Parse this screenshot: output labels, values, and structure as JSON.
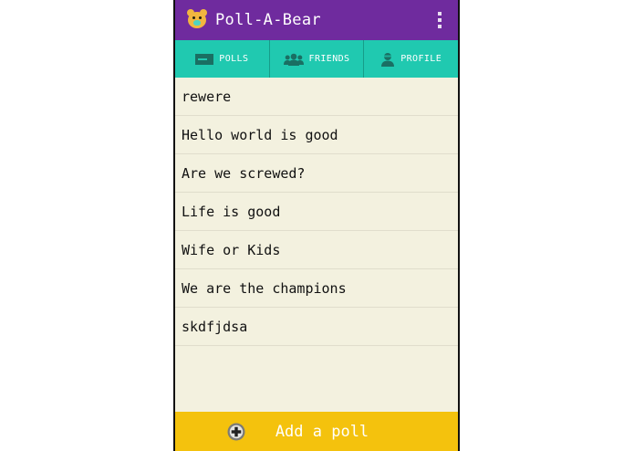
{
  "app": {
    "title": "Poll-A-Bear"
  },
  "colors": {
    "topbar": "#6f2b9e",
    "tabs": "#20c9b0",
    "list_background": "#f3f1df",
    "add_bar": "#f4c20d",
    "bear": "#f2b63f"
  },
  "tabs": [
    {
      "label": "POLLS",
      "icon": "polls-icon"
    },
    {
      "label": "FRIENDS",
      "icon": "friends-icon"
    },
    {
      "label": "PROFILE",
      "icon": "profile-icon"
    }
  ],
  "polls": [
    "rewere",
    "Hello world is good",
    "Are we screwed?",
    "Life is good",
    "Wife or Kids",
    "We are the champions",
    "skdfjdsa"
  ],
  "add_bar": {
    "label": "Add a poll",
    "icon": "plus-circle-icon"
  }
}
